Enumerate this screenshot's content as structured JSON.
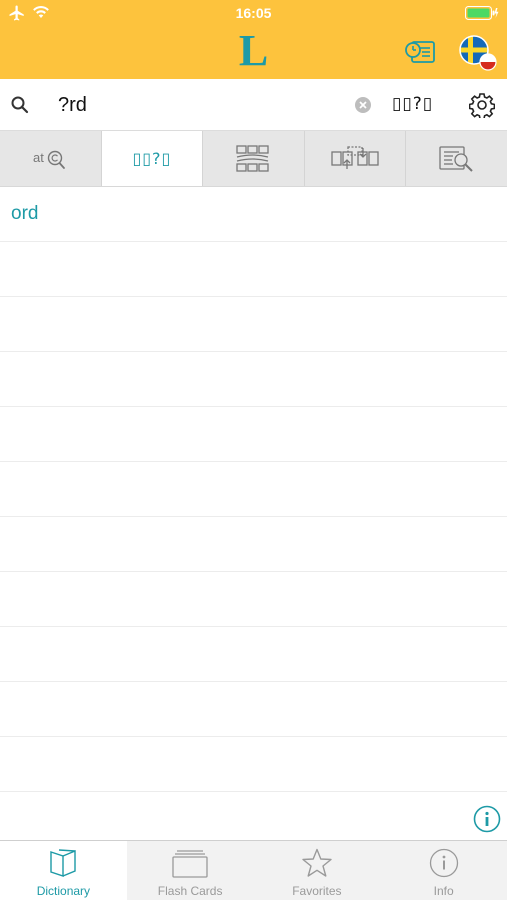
{
  "status_bar": {
    "time": "16:05"
  },
  "header": {
    "logo_letter": "L",
    "icons": [
      "airplane-icon",
      "wifi-icon",
      "battery-icon",
      "history-icon",
      "swedish-flag-icon"
    ]
  },
  "search": {
    "query": "?rd",
    "wildcard_label": "▯▯?▯",
    "icons": [
      "search-icon",
      "clear-icon",
      "gear-icon"
    ]
  },
  "mode_tabs": [
    {
      "name": "at-search",
      "icon": "at-search-icon"
    },
    {
      "name": "wildcard",
      "label": "▯▯?▯",
      "active": true
    },
    {
      "name": "crossword",
      "icon": "crossword-icon"
    },
    {
      "name": "anagram",
      "icon": "anagram-icon"
    },
    {
      "name": "fulltext",
      "icon": "fulltext-search-icon"
    }
  ],
  "results": [
    {
      "text": "ord"
    }
  ],
  "tab_bar": {
    "items": [
      {
        "label": "Dictionary",
        "icon": "book-icon",
        "active": true
      },
      {
        "label": "Flash Cards",
        "icon": "cards-icon"
      },
      {
        "label": "Favorites",
        "icon": "star-icon"
      },
      {
        "label": "Info",
        "icon": "info-icon"
      }
    ]
  },
  "colors": {
    "header": "#FDC33D",
    "accent": "#1D9AA6",
    "tab_background": "#E6E6E6",
    "tab_bar_background": "#F2F2F2"
  }
}
